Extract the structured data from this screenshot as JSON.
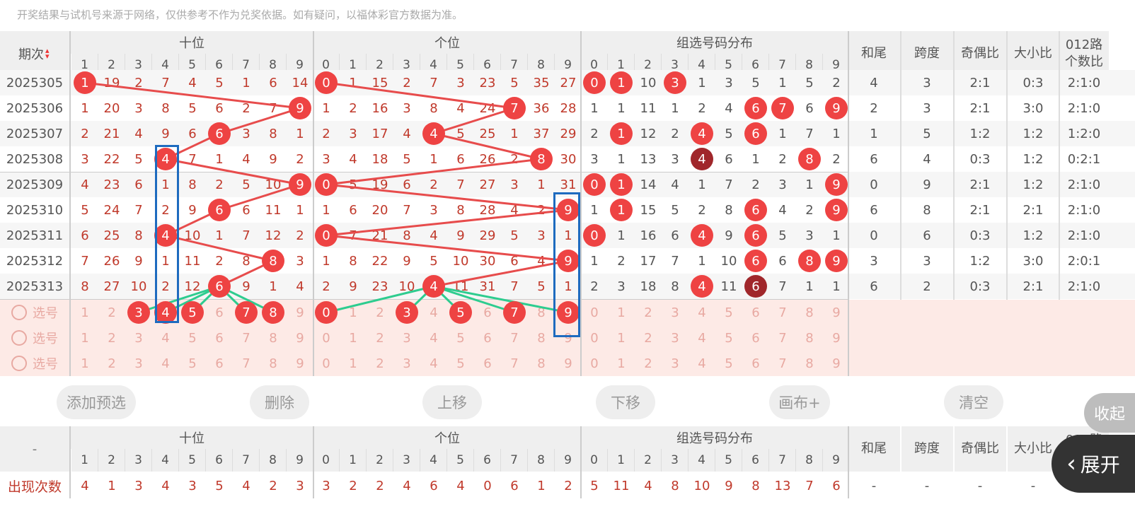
{
  "notice": "开奖结果与试机号来源于网络，仅供参考不作为兑奖依据。如有疑问，以福体彩官方数据为准。",
  "header": {
    "period_label": "期次",
    "groups": [
      "十位",
      "个位",
      "组选号码分布"
    ],
    "extra_cols": [
      "和尾",
      "跨度",
      "奇偶比",
      "大小比",
      "012路个数比"
    ],
    "digits_shi": [
      "1",
      "2",
      "3",
      "4",
      "5",
      "6",
      "7",
      "8",
      "9"
    ],
    "digits_ge": [
      "0",
      "1",
      "2",
      "3",
      "4",
      "5",
      "6",
      "7",
      "8",
      "9"
    ],
    "digits_zu": [
      "0",
      "1",
      "2",
      "3",
      "4",
      "5",
      "6",
      "7",
      "8",
      "9"
    ]
  },
  "rows": [
    {
      "period": "2025305",
      "shi": [
        "1",
        "19",
        "2",
        "7",
        "4",
        "5",
        "1",
        "6",
        "14"
      ],
      "ge": [
        "0",
        "1",
        "15",
        "2",
        "7",
        "3",
        "23",
        "5",
        "35",
        "27"
      ],
      "zu": [
        "0",
        "1",
        "10",
        "3",
        "1",
        "3",
        "5",
        "1",
        "5",
        "2"
      ],
      "hw": "4",
      "kd": "3",
      "jo": "2:1",
      "dx": "0:3",
      "lu": "2:1:0"
    },
    {
      "period": "2025306",
      "shi": [
        "1",
        "20",
        "3",
        "8",
        "5",
        "6",
        "2",
        "7",
        "9"
      ],
      "ge": [
        "1",
        "2",
        "16",
        "3",
        "8",
        "4",
        "24",
        "7",
        "36",
        "28"
      ],
      "zu": [
        "1",
        "1",
        "11",
        "1",
        "2",
        "4",
        "6",
        "7",
        "6",
        "9"
      ],
      "hw": "2",
      "kd": "3",
      "jo": "2:1",
      "dx": "3:0",
      "lu": "2:1:0"
    },
    {
      "period": "2025307",
      "shi": [
        "2",
        "21",
        "4",
        "9",
        "6",
        "6",
        "3",
        "8",
        "1"
      ],
      "ge": [
        "2",
        "3",
        "17",
        "4",
        "4",
        "5",
        "25",
        "1",
        "37",
        "29"
      ],
      "zu": [
        "2",
        "1",
        "12",
        "2",
        "4",
        "5",
        "6",
        "1",
        "7",
        "1"
      ],
      "hw": "1",
      "kd": "5",
      "jo": "1:2",
      "dx": "1:2",
      "lu": "1:2:0"
    },
    {
      "period": "2025308",
      "shi": [
        "3",
        "22",
        "5",
        "4",
        "7",
        "1",
        "4",
        "9",
        "2"
      ],
      "ge": [
        "3",
        "4",
        "18",
        "5",
        "1",
        "6",
        "26",
        "2",
        "8",
        "30"
      ],
      "zu": [
        "3",
        "1",
        "13",
        "3",
        "4",
        "6",
        "1",
        "2",
        "8",
        "2"
      ],
      "hw": "6",
      "kd": "4",
      "jo": "0:3",
      "dx": "1:2",
      "lu": "0:2:1"
    },
    {
      "period": "2025309",
      "shi": [
        "4",
        "23",
        "6",
        "1",
        "8",
        "2",
        "5",
        "10",
        "9"
      ],
      "ge": [
        "0",
        "5",
        "19",
        "6",
        "2",
        "7",
        "27",
        "3",
        "1",
        "31"
      ],
      "zu": [
        "0",
        "1",
        "14",
        "4",
        "1",
        "7",
        "2",
        "3",
        "1",
        "9"
      ],
      "hw": "0",
      "kd": "9",
      "jo": "2:1",
      "dx": "1:2",
      "lu": "2:1:0"
    },
    {
      "period": "2025310",
      "shi": [
        "5",
        "24",
        "7",
        "2",
        "9",
        "6",
        "6",
        "11",
        "1"
      ],
      "ge": [
        "1",
        "6",
        "20",
        "7",
        "3",
        "8",
        "28",
        "4",
        "2",
        "9"
      ],
      "zu": [
        "1",
        "1",
        "15",
        "5",
        "2",
        "8",
        "6",
        "4",
        "2",
        "9"
      ],
      "hw": "6",
      "kd": "8",
      "jo": "2:1",
      "dx": "2:1",
      "lu": "2:1:0"
    },
    {
      "period": "2025311",
      "shi": [
        "6",
        "25",
        "8",
        "4",
        "10",
        "1",
        "7",
        "12",
        "2"
      ],
      "ge": [
        "0",
        "7",
        "21",
        "8",
        "4",
        "9",
        "29",
        "5",
        "3",
        "1"
      ],
      "zu": [
        "0",
        "1",
        "16",
        "6",
        "4",
        "9",
        "6",
        "5",
        "3",
        "1"
      ],
      "hw": "0",
      "kd": "6",
      "jo": "0:3",
      "dx": "1:2",
      "lu": "2:1:0"
    },
    {
      "period": "2025312",
      "shi": [
        "7",
        "26",
        "9",
        "1",
        "11",
        "2",
        "8",
        "8",
        "3"
      ],
      "ge": [
        "1",
        "8",
        "22",
        "9",
        "5",
        "10",
        "30",
        "6",
        "4",
        "9"
      ],
      "zu": [
        "1",
        "2",
        "17",
        "7",
        "1",
        "10",
        "6",
        "6",
        "8",
        "9"
      ],
      "hw": "3",
      "kd": "3",
      "jo": "1:2",
      "dx": "3:0",
      "lu": "2:0:1"
    },
    {
      "period": "2025313",
      "shi": [
        "8",
        "27",
        "10",
        "2",
        "12",
        "6",
        "9",
        "1",
        "4"
      ],
      "ge": [
        "2",
        "9",
        "23",
        "10",
        "4",
        "11",
        "31",
        "7",
        "5",
        "1"
      ],
      "zu": [
        "2",
        "3",
        "18",
        "8",
        "4",
        "11",
        "6",
        "7",
        "1",
        "1"
      ],
      "hw": "6",
      "kd": "2",
      "jo": "0:3",
      "dx": "2:1",
      "lu": "2:1:0"
    }
  ],
  "select_label": "选号",
  "buttons": [
    "添加预选",
    "删除",
    "上移",
    "下移",
    "画布+",
    "清空"
  ],
  "collapse_label": "收起",
  "expand_label": "展开",
  "footer": {
    "dash": "-",
    "count_label": "出现次数",
    "shi": [
      "4",
      "1",
      "3",
      "4",
      "3",
      "5",
      "4",
      "2",
      "3"
    ],
    "ge": [
      "3",
      "2",
      "2",
      "4",
      "6",
      "4",
      "0",
      "6",
      "1",
      "2"
    ],
    "zu": [
      "5",
      "11",
      "4",
      "8",
      "10",
      "9",
      "8",
      "13",
      "7",
      "6"
    ],
    "extra": [
      "-",
      "-",
      "-",
      "-",
      "-"
    ]
  },
  "colors": {
    "ball": "#ee4343",
    "ball_dark": "#a0272b",
    "line_red": "#e74c4c",
    "line_green": "#2ecc8f",
    "box_blue": "#1e6bbf"
  }
}
